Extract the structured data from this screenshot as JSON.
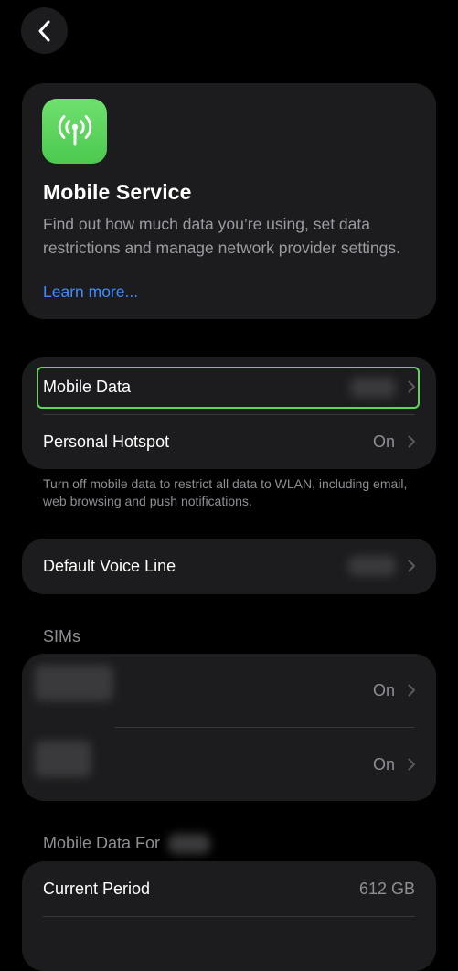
{
  "nav": {
    "back_icon": "chevron-left-icon"
  },
  "hero": {
    "icon": "antenna-signal-icon",
    "icon_color": "#5ad45a",
    "title": "Mobile Service",
    "description": "Find out how much data you’re using, set data restrictions and manage network provider settings.",
    "learn_more": "Learn more..."
  },
  "data_group": {
    "mobile_data_label": "Mobile Data",
    "personal_hotspot_label": "Personal Hotspot",
    "personal_hotspot_value": "On"
  },
  "data_footnote": "Turn off mobile data to restrict all data to WLAN, including email, web browsing and push notifications.",
  "voice": {
    "default_voice_line_label": "Default Voice Line"
  },
  "sims": {
    "header": "SIMs",
    "items": [
      {
        "value": "On"
      },
      {
        "value": "On"
      }
    ]
  },
  "usage": {
    "header": "Mobile Data For",
    "current_period_label": "Current Period",
    "current_period_value": "612 GB"
  },
  "colors": {
    "background": "#000000",
    "card": "#1c1c1e",
    "accent_link": "#3d8cff",
    "focus_outline": "#5ed65a"
  }
}
